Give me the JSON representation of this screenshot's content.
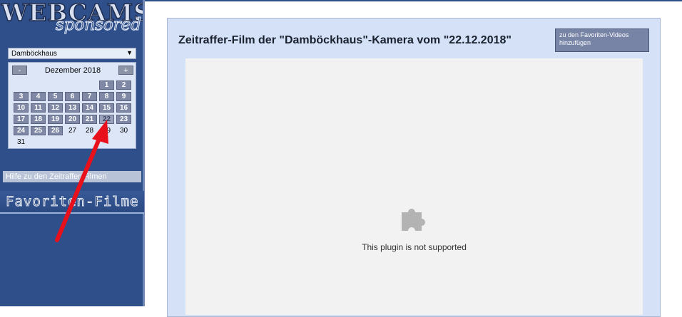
{
  "logo": {
    "line1": "WEBCAMS",
    "line2": "sponsored"
  },
  "camera_select": {
    "value": "Damböckhaus"
  },
  "calendar": {
    "month_label": "Dezember 2018",
    "prev_label": "-",
    "next_label": "+",
    "days": [
      {
        "day": "1",
        "linked": true
      },
      {
        "day": "2",
        "linked": true
      },
      {
        "day": "3",
        "linked": true
      },
      {
        "day": "4",
        "linked": true
      },
      {
        "day": "5",
        "linked": true
      },
      {
        "day": "6",
        "linked": true
      },
      {
        "day": "7",
        "linked": true
      },
      {
        "day": "8",
        "linked": true
      },
      {
        "day": "9",
        "linked": true
      },
      {
        "day": "10",
        "linked": true
      },
      {
        "day": "11",
        "linked": true
      },
      {
        "day": "12",
        "linked": true
      },
      {
        "day": "13",
        "linked": true
      },
      {
        "day": "14",
        "linked": true
      },
      {
        "day": "15",
        "linked": true
      },
      {
        "day": "16",
        "linked": true
      },
      {
        "day": "17",
        "linked": true
      },
      {
        "day": "18",
        "linked": true
      },
      {
        "day": "19",
        "linked": true
      },
      {
        "day": "20",
        "linked": true
      },
      {
        "day": "21",
        "linked": true
      },
      {
        "day": "22",
        "linked": true,
        "selected": true
      },
      {
        "day": "23",
        "linked": true
      },
      {
        "day": "24",
        "linked": true
      },
      {
        "day": "25",
        "linked": true
      },
      {
        "day": "26",
        "linked": true
      },
      {
        "day": "27",
        "linked": false
      },
      {
        "day": "28",
        "linked": false
      },
      {
        "day": "29",
        "linked": false
      },
      {
        "day": "30",
        "linked": false
      },
      {
        "day": "31",
        "linked": false
      }
    ]
  },
  "sidebar": {
    "help_link": "Hilfe zu den Zeitraffer-Filmen",
    "favorites_heading": "Favoriten-Filme"
  },
  "main": {
    "title": "Zeitraffer-Film der \"Damböckhaus\"-Kamera vom \"22.12.2018\"",
    "fav_button": "zu den Favoriten-Videos hinzufügen",
    "plugin_message": "This plugin is not supported"
  },
  "annotation": {
    "arrow_color": "#e8101a"
  }
}
